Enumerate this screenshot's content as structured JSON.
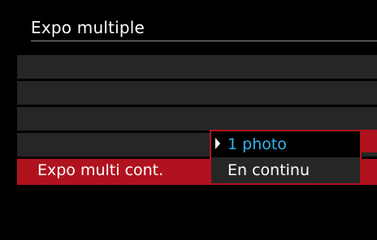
{
  "screen": {
    "title": "Expo multiple"
  },
  "menu": {
    "selected_row_label": "Expo multi cont."
  },
  "dropdown": {
    "options": [
      {
        "label": "1 photo",
        "highlighted": true
      },
      {
        "label": "En continu",
        "highlighted": false
      }
    ]
  },
  "colors": {
    "accent": "#b0131e",
    "highlight_text": "#32b6f0",
    "row_background": "#262626"
  }
}
